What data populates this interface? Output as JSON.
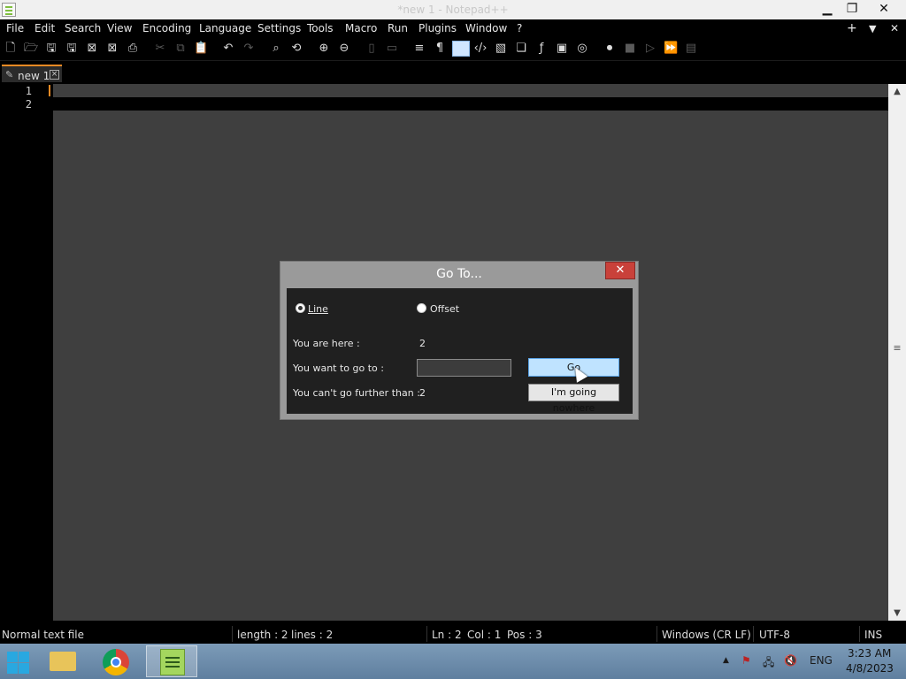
{
  "window": {
    "title": "*new 1 - Notepad++",
    "min_glyph": "▁",
    "max_glyph": "❐",
    "close_glyph": "✕"
  },
  "menu": {
    "items": [
      "File",
      "Edit",
      "Search",
      "View",
      "Encoding",
      "Language",
      "Settings",
      "Tools",
      "Macro",
      "Run",
      "Plugins",
      "Window",
      "?"
    ],
    "right_add": "+",
    "right_dropdown": "▼",
    "right_close": "✕"
  },
  "toolbar": {
    "icons": [
      "new-file-icon",
      "open-file-icon",
      "save-icon",
      "save-all-icon",
      "close-icon",
      "close-all-icon",
      "print-icon",
      "cut-icon",
      "copy-icon",
      "paste-icon",
      "undo-icon",
      "redo-icon",
      "find-icon",
      "replace-icon",
      "zoom-in-icon",
      "zoom-out-icon",
      "sync-vertical-icon",
      "sync-horizontal-icon",
      "word-wrap-icon",
      "show-all-chars-icon",
      "indent-guide-icon",
      "xml-tag-icon",
      "document-map-icon",
      "document-list-icon",
      "function-list-icon",
      "folder-as-workspace-icon",
      "monitoring-icon",
      "record-macro-icon",
      "stop-record-icon",
      "play-macro-icon",
      "run-macro-multiple-icon",
      "save-macro-icon"
    ]
  },
  "tabs": [
    {
      "label": "new 1",
      "pencil": "✎",
      "close": "×"
    }
  ],
  "editor": {
    "line_numbers": [
      "1",
      "2"
    ]
  },
  "statusbar": {
    "file_type": "Normal text file",
    "length": "length : 2",
    "lines": "lines : 2",
    "ln": "Ln : 2",
    "col": "Col : 1",
    "pos": "Pos : 3",
    "eol": "Windows (CR LF)",
    "encoding": "UTF-8",
    "mode": "INS"
  },
  "dialog": {
    "title": "Go To...",
    "close_glyph": "✕",
    "radio_line": "Line",
    "radio_offset": "Offset",
    "you_are_here_label": "You are here :",
    "you_are_here_value": "2",
    "want_to_go_label": "You want to go to :",
    "input_value": "",
    "cant_go_label": "You can't go further than :",
    "cant_go_value": "2",
    "go_label": "Go",
    "nowhere_label": "I'm going nowhere"
  },
  "taskbar": {
    "apps": [
      "file-explorer",
      "chrome",
      "notepad-plus-plus"
    ],
    "tray_arrow": "▲",
    "language": "ENG",
    "time": "3:23 AM",
    "date": "4/8/2023"
  },
  "colors": {
    "accent_orange": "#f08a24",
    "dialog_close_red": "#c9413a",
    "go_button_blue": "#bfe3ff",
    "editor_bg": "#3f3f3f"
  }
}
